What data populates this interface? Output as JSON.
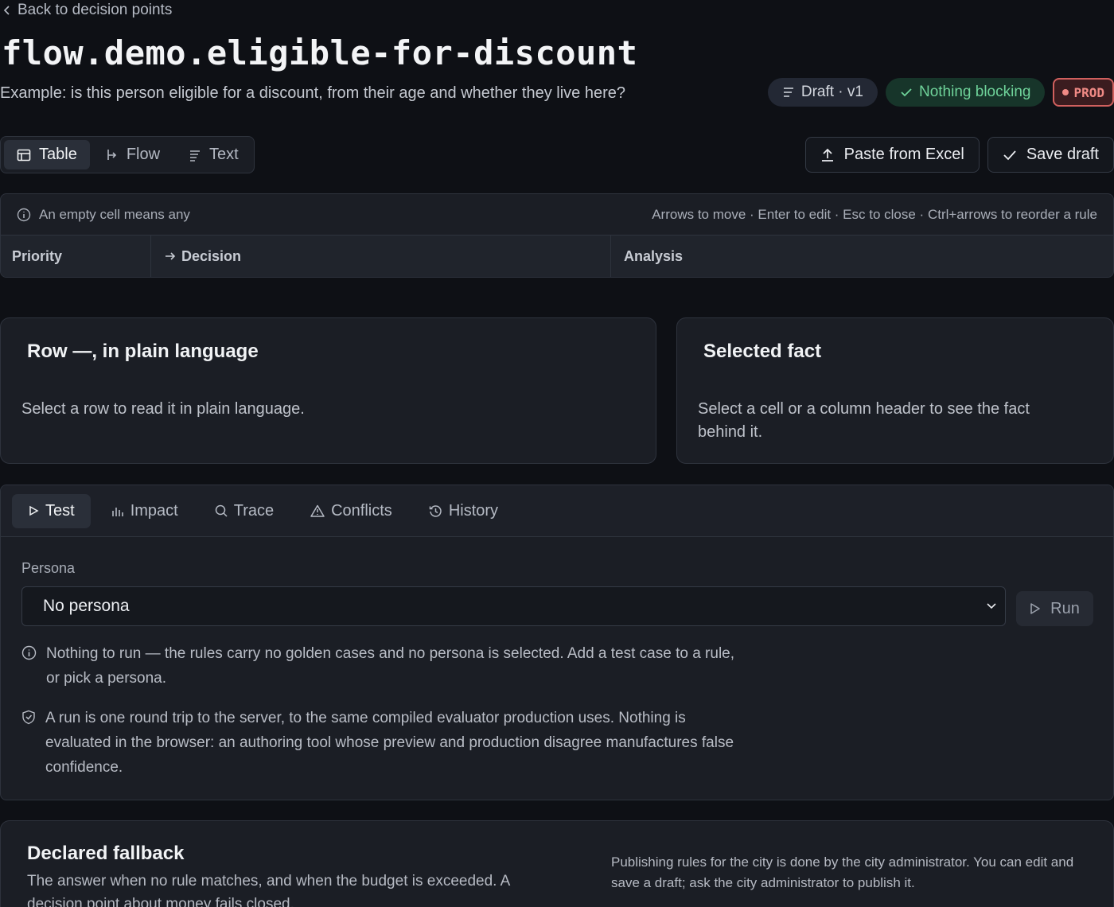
{
  "nav": {
    "back_label": "Back to decision points"
  },
  "header": {
    "title": "flow.demo.eligible-for-discount",
    "subtitle": "Example: is this person eligible for a discount, from their age and whether they live here?",
    "badges": {
      "draft": "Draft · v1",
      "status": "Nothing blocking",
      "env": "PROD"
    }
  },
  "view_switch": {
    "table": "Table",
    "flow": "Flow",
    "text": "Text"
  },
  "actions": {
    "paste": "Paste from Excel",
    "save": "Save draft"
  },
  "table": {
    "info_left": "An empty cell means any",
    "info_right": "Arrows to move · Enter to edit · Esc to close · Ctrl+arrows to reorder a rule",
    "columns": [
      "Priority",
      "Decision",
      "Analysis"
    ]
  },
  "row_card": {
    "title": "Row —, in plain language",
    "body": "Select a row to read it in plain language."
  },
  "fact_card": {
    "title": "Selected fact",
    "body": "Select a cell or a column header to see the fact behind it."
  },
  "tabs": [
    "Test",
    "Impact",
    "Trace",
    "Conflicts",
    "History"
  ],
  "test": {
    "persona_label": "Persona",
    "persona_value": "No persona",
    "run_label": "Run",
    "note_1": "Nothing to run — the rules carry no golden cases and no persona is selected. Add a test case to a rule, or pick a persona.",
    "note_2": "A run is one round trip to the server, to the same compiled evaluator production uses. Nothing is evaluated in the browser: an authoring tool whose preview and production disagree manufactures false confidence."
  },
  "fallback": {
    "title": "Declared fallback",
    "body": "The answer when no rule matches, and when the budget is exceeded. A decision point about money fails closed.",
    "permission_note": "Publishing rules for the city is done by the city administrator. You can edit and save a draft; ask the city administrator to publish it."
  },
  "colors": {
    "accent_ok": "#6fd39a",
    "prod": "#f08a85",
    "bg": "#0e1015",
    "panel": "#1b1e25"
  }
}
